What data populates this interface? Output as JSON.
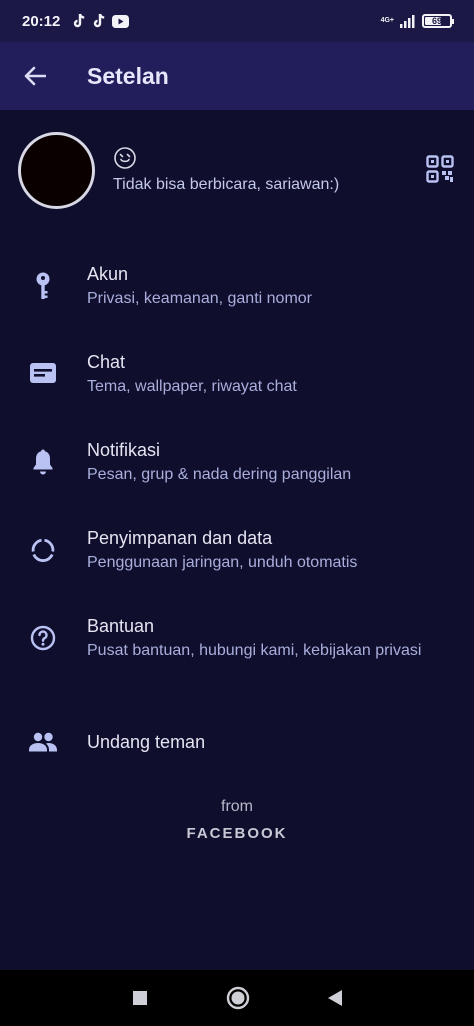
{
  "status_bar": {
    "time": "20:12",
    "network": "4G+",
    "battery": "69",
    "battery_level": 0.69
  },
  "app_bar": {
    "title": "Setelan"
  },
  "profile": {
    "status": "Tidak bisa berbicara, sariawan:)"
  },
  "menu": {
    "items": [
      {
        "label": "Akun",
        "sub": "Privasi, keamanan, ganti nomor",
        "icon": "key-icon"
      },
      {
        "label": "Chat",
        "sub": "Tema, wallpaper, riwayat chat",
        "icon": "chat-icon"
      },
      {
        "label": "Notifikasi",
        "sub": "Pesan, grup & nada dering panggilan",
        "icon": "bell-icon"
      },
      {
        "label": "Penyimpanan dan data",
        "sub": "Penggunaan jaringan, unduh otomatis",
        "icon": "data-usage-icon"
      },
      {
        "label": "Bantuan",
        "sub": "Pusat bantuan, hubungi kami, kebijakan privasi",
        "icon": "help-icon"
      },
      {
        "label": "Undang teman",
        "icon": "people-icon"
      }
    ]
  },
  "footer": {
    "from": "from",
    "brand": "FACEBOOK"
  },
  "colors": {
    "background": "#0f0e2c",
    "app_bar": "#221e5c",
    "status_bar": "#1b1846",
    "subtitle": "#a9aedc",
    "icon_accent": "#b9c2f2"
  }
}
